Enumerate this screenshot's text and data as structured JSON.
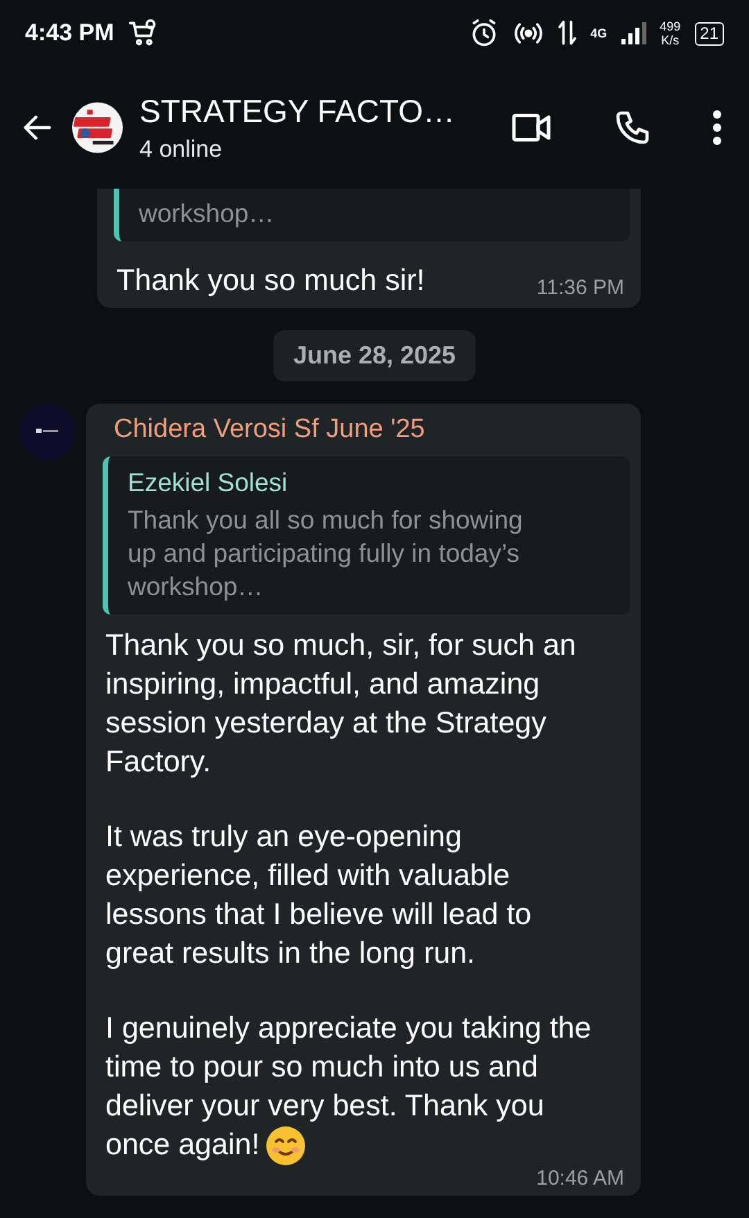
{
  "status_bar": {
    "time": "4:43 PM",
    "network_type": "4G",
    "speed": "499",
    "speed_unit": "K/s",
    "battery": "21"
  },
  "header": {
    "title": "STRATEGY FACTO…",
    "subtitle": "4 online"
  },
  "messages": [
    {
      "kind": "message",
      "quote": {
        "lines": [
          "workshop…"
        ]
      },
      "paragraphs": [
        "Thank you so much sir!"
      ],
      "time": "11:36 PM",
      "trailing_emoji": false
    },
    {
      "kind": "date",
      "text": "June 28, 2025"
    },
    {
      "kind": "message",
      "sender": "Chidera Verosi Sf June '25",
      "quote": {
        "author": "Ezekiel Solesi",
        "lines": [
          "Thank you all so much for showing up and participating fully in today’s workshop…"
        ]
      },
      "paragraphs": [
        "Thank you so much, sir, for such an inspiring, impactful, and amazing session yesterday at the Strategy Factory.",
        "It was truly an eye-opening experience, filled with valuable lessons that I believe will lead to great results in the long run.",
        "I genuinely appreciate you taking the time to pour so much into us and deliver your very best. Thank you once again!"
      ],
      "time": "10:46 AM",
      "trailing_emoji": true
    }
  ]
}
